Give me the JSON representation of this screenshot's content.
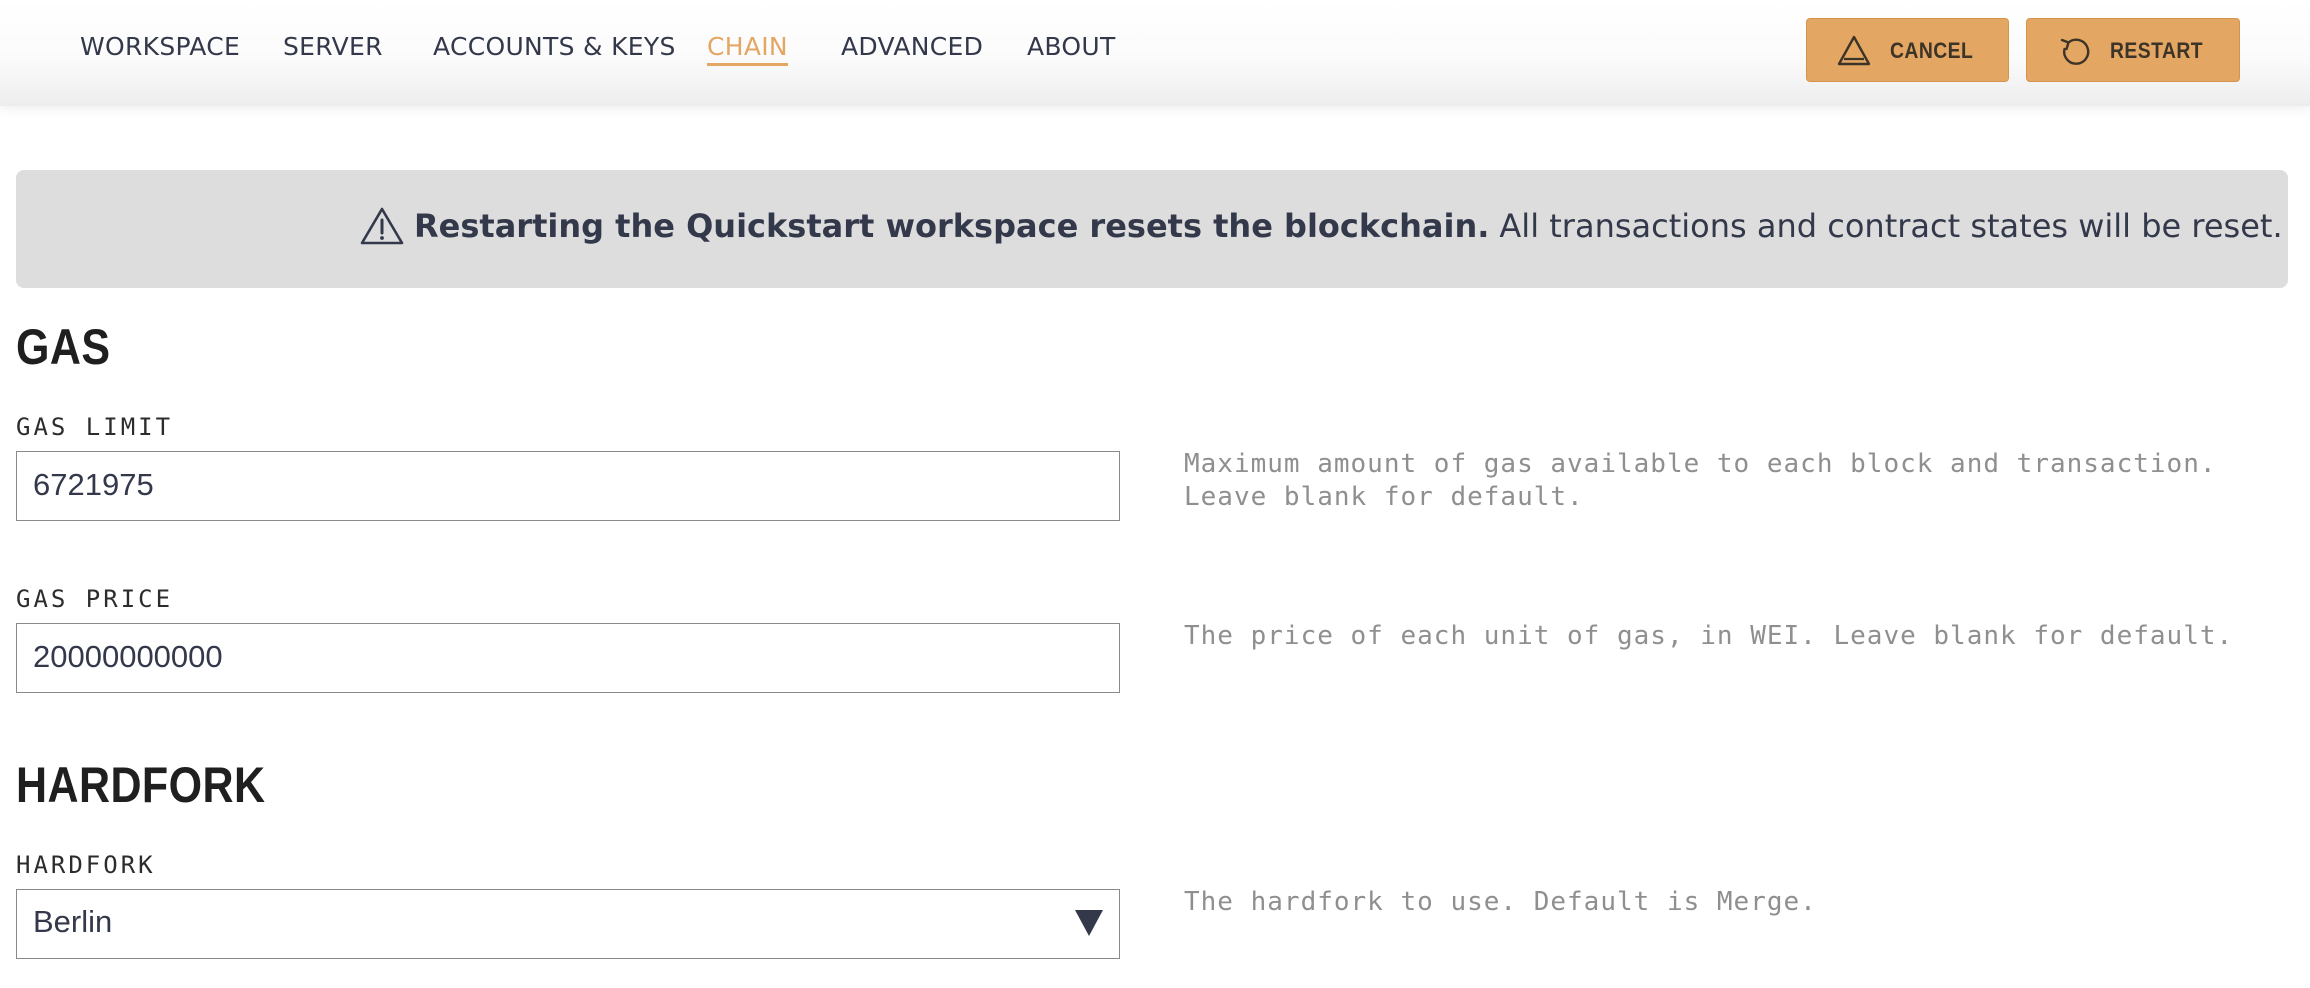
{
  "nav": {
    "tabs": [
      {
        "label": "WORKSPACE"
      },
      {
        "label": "SERVER"
      },
      {
        "label": "ACCOUNTS & KEYS"
      },
      {
        "label": "CHAIN",
        "active": true
      },
      {
        "label": "ADVANCED"
      },
      {
        "label": "ABOUT"
      }
    ],
    "accent_color": "#e4a663",
    "cancel_label": "CANCEL",
    "cancel_icon": "warning-triangle-icon",
    "restart_label": "RESTART",
    "restart_icon": "restart-icon"
  },
  "banner": {
    "icon": "warning-triangle-icon",
    "bold_text": "Restarting the Quickstart workspace resets the blockchain.",
    "text": "All transactions and contract states will be reset."
  },
  "gas": {
    "title": "GAS",
    "limit_label": "GAS LIMIT",
    "limit_value": "6721975",
    "limit_help": "Maximum amount of gas available to each block and transaction.\nLeave blank for default.",
    "price_label": "GAS PRICE",
    "price_value": "20000000000",
    "price_help": "The price of each unit of gas, in WEI. Leave blank for default."
  },
  "hardfork": {
    "title": "HARDFORK",
    "label": "HARDFORK",
    "selected": "Berlin",
    "help": "The hardfork to use. Default is Merge."
  }
}
